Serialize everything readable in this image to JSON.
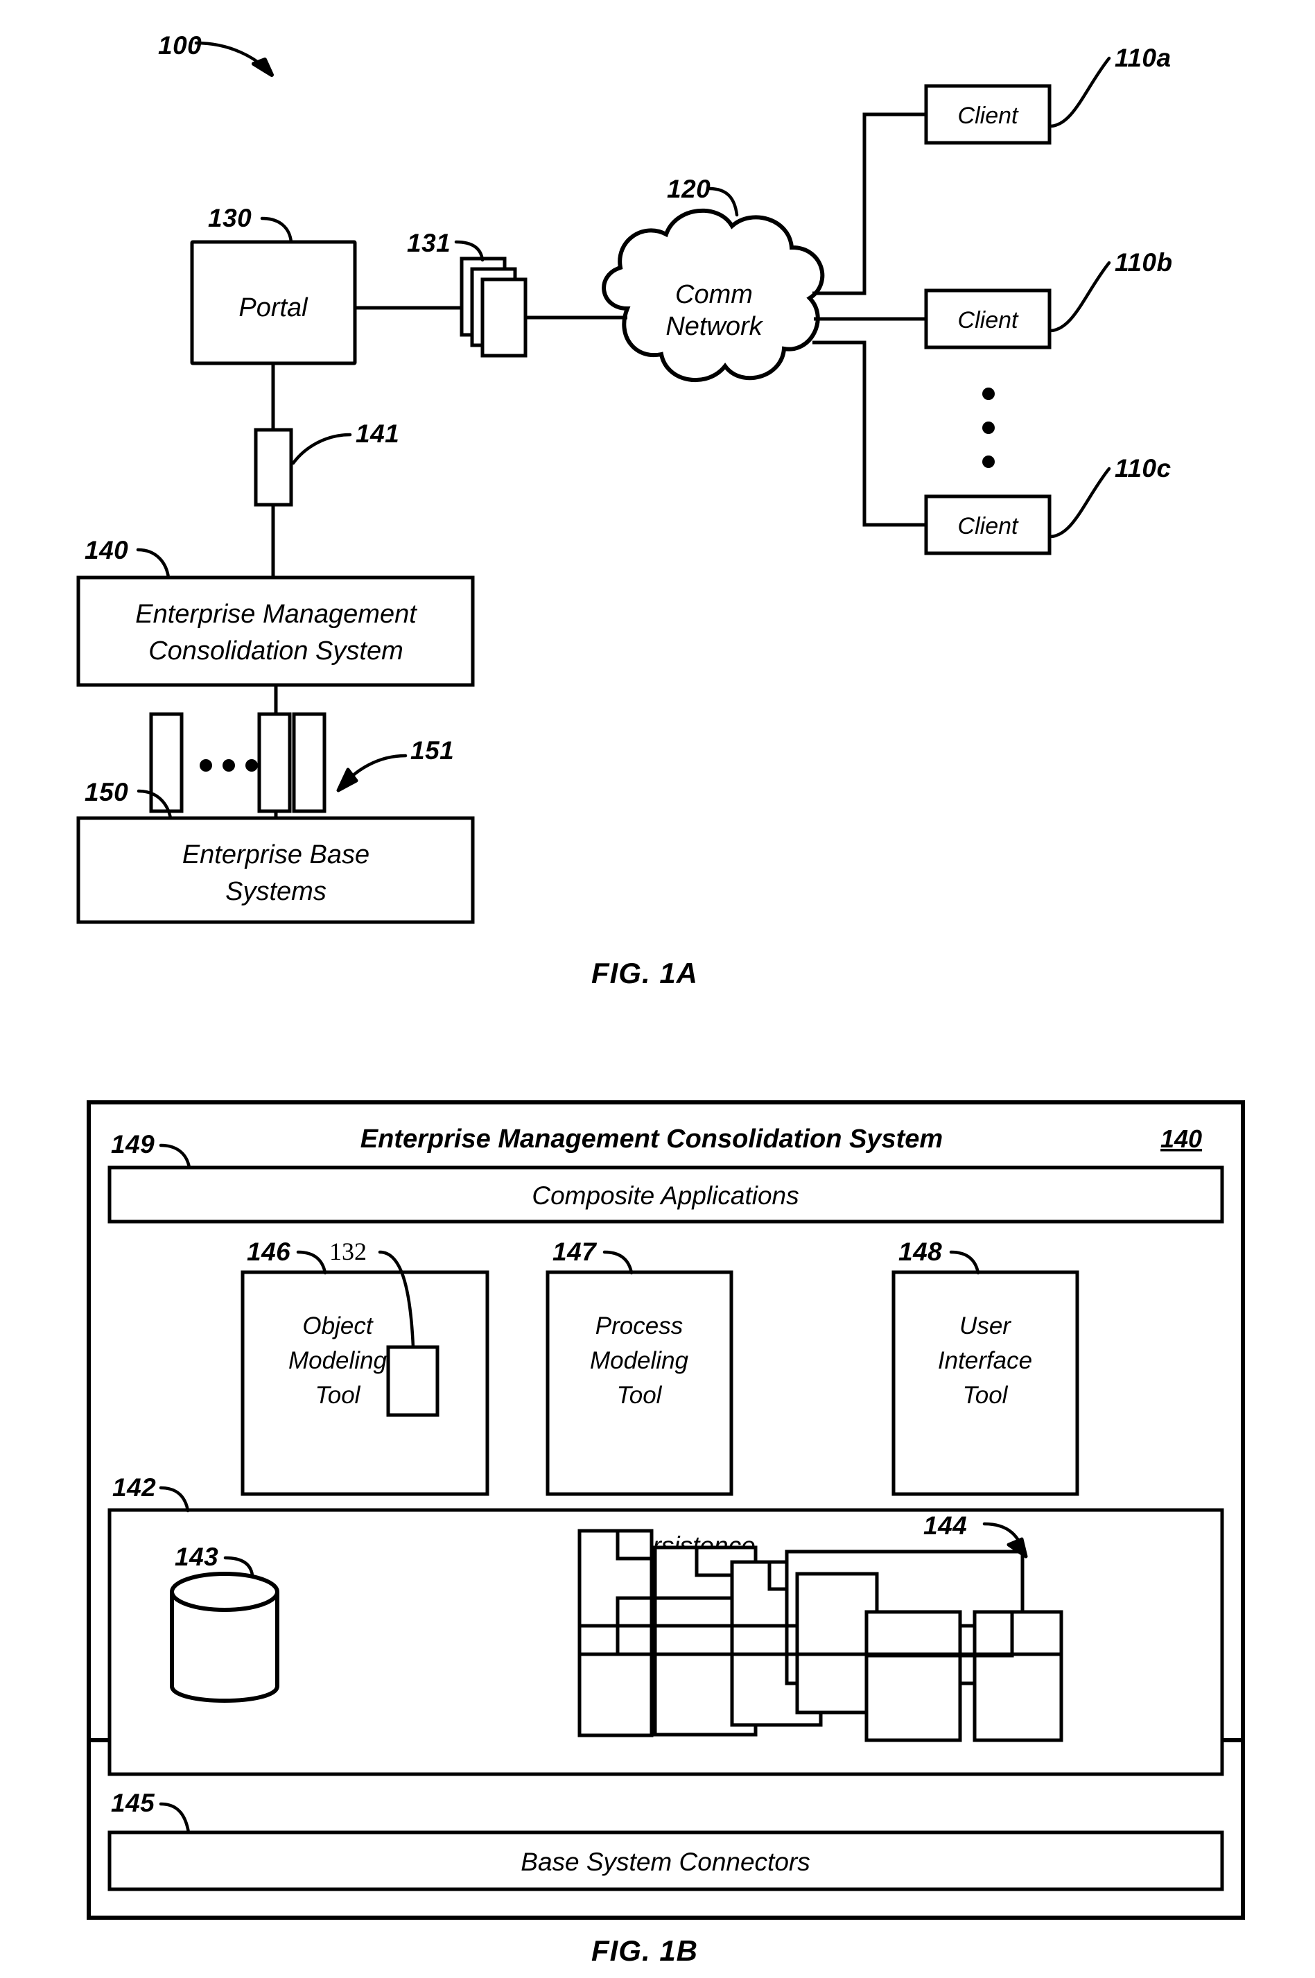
{
  "figures": [
    {
      "id": "fig-1a",
      "caption": "FIG. 1A",
      "system_ref": "100",
      "nodes": {
        "portal": {
          "label": "Portal",
          "ref": "130"
        },
        "documents": {
          "ref": "131"
        },
        "network": {
          "label_line1": "Comm",
          "label_line2": "Network",
          "ref": "120"
        },
        "clients": [
          {
            "label": "Client",
            "ref": "110a"
          },
          {
            "label": "Client",
            "ref": "110b"
          },
          {
            "label": "Client",
            "ref": "110c"
          }
        ],
        "client_ellipsis": "⋮",
        "connector_portal": {
          "ref": "141"
        },
        "emcs": {
          "label_line1": "Enterprise Management",
          "label_line2": "Consolidation System",
          "ref": "140"
        },
        "connectors_base": {
          "ref": "151",
          "ellipsis": "···"
        },
        "base_systems": {
          "label_line1": "Enterprise Base",
          "label_line2": "Systems",
          "ref": "150"
        }
      }
    },
    {
      "id": "fig-1b",
      "caption": "FIG. 1B",
      "title": "Enterprise Management Consolidation System",
      "title_ref": "140",
      "bands": {
        "composite_applications": {
          "label": "Composite Applications",
          "ref": "149"
        },
        "persistence": {
          "label": "Persistence",
          "ref": "142"
        },
        "base_system_connectors": {
          "label": "Base System Connectors",
          "ref": "145"
        }
      },
      "tools": [
        {
          "label_line1": "Object",
          "label_line2": "Modeling",
          "label_line3": "Tool",
          "ref": "146",
          "inner_ref": "132"
        },
        {
          "label_line1": "Process",
          "label_line2": "Modeling",
          "label_line3": "Tool",
          "ref": "147"
        },
        {
          "label_line1": "User",
          "label_line2": "Interface",
          "label_line3": "Tool",
          "ref": "148"
        }
      ],
      "persistence_items": {
        "database": {
          "ref": "143"
        },
        "object_cluster": {
          "ref": "144"
        }
      }
    }
  ]
}
